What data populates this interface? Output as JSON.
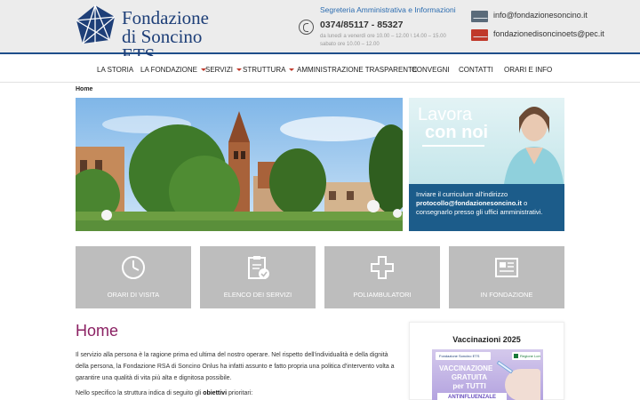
{
  "header": {
    "logo": {
      "line1": "Fondazione",
      "line2": "di Soncino ETS"
    },
    "secretary": "Segreteria Amministrativa e Informazioni",
    "phone": "0374/85117 - 85327",
    "hours_weekdays": "da lunedì a venerdì ore 10.00 – 12.00 \\ 14.00 – 15.00",
    "hours_saturday": "sabato ore 10.00 – 12.00",
    "email": "info@fondazionesoncino.it",
    "pec": "fondazionedisoncinoets@pec.it"
  },
  "nav": {
    "items": [
      {
        "label": "LA STORIA",
        "has_dropdown": false
      },
      {
        "label": "LA FONDAZIONE",
        "has_dropdown": true
      },
      {
        "label": "SERVIZI",
        "has_dropdown": true
      },
      {
        "label": "STRUTTURA",
        "has_dropdown": true
      },
      {
        "label": "AMMINISTRAZIONE TRASPARENTE",
        "has_dropdown": false
      },
      {
        "label": "CONVEGNI",
        "has_dropdown": false
      },
      {
        "label": "CONTATTI",
        "has_dropdown": false
      },
      {
        "label": "ORARI E INFO",
        "has_dropdown": false
      }
    ]
  },
  "breadcrumb": "Home",
  "promo": {
    "title_line1": "Lavora",
    "title_line2": "con noi",
    "text_pre": "Inviare il curriculum all'indirizzo",
    "text_email": "protocollo@fondazionesoncino.it",
    "text_post": "o consegnarlo presso gli uffici amministrativi."
  },
  "tiles": [
    {
      "label": "ORARI DI VISITA",
      "icon": "clock-icon"
    },
    {
      "label": "ELENCO DEI SERVIZI",
      "icon": "clipboard-check-icon"
    },
    {
      "label": "POLIAMBULATORI",
      "icon": "medical-cross-icon"
    },
    {
      "label": "IN FONDAZIONE",
      "icon": "newspaper-icon"
    }
  ],
  "content": {
    "title": "Home",
    "paragraph1": "Il servizio alla persona è la ragione prima ed ultima del nostro operare. Nel rispetto dell'individualità e della dignità della persona, la Fondazione RSA di Soncino Onlus ha infatti assunto e fatto propria una politica d'intervento volta a garantire una qualità di vita più alta e dignitosa possibile.",
    "paragraph2_pre": "Nello specifico la struttura indica di seguito gli ",
    "paragraph2_bold": "obiettivi",
    "paragraph2_post": " prioritari:"
  },
  "sidebar": {
    "title": "Vaccinazioni 2025",
    "banner": {
      "logo_left": "Fondazione Soncino ETS",
      "logo_right": "Regione Lombardia",
      "line1": "VACCINAZIONE",
      "line2": "GRATUITA",
      "line3": "per TUTTI",
      "line4": "ANTINFLUENZALE"
    }
  },
  "colors": {
    "brand_blue": "#1e3f78",
    "nav_caret": "#c0392b",
    "tile_gray": "#bdbdbd",
    "title_magenta": "#8b2163",
    "promo_band": "#1c5c8a"
  }
}
